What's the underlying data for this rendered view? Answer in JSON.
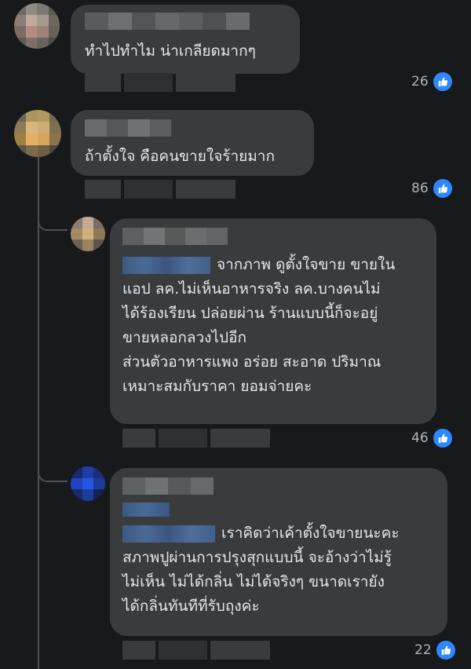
{
  "comments": [
    {
      "text_lines": [
        "ทำไปทำไม น่าเกลียดมากๆ"
      ],
      "likes": "26"
    },
    {
      "text_lines": [
        "ถ้าตั้งใจ คือคนขายใจร้ายมาก"
      ],
      "likes": "86"
    }
  ],
  "replies": [
    {
      "text_lines": [
        "จากภาพ ดูตั้งใจขาย ขายใน",
        "แอป ลค.ไม่เห็นอาหารจริง  ลค.บางคนไม่",
        "ได้ร้องเรียน ปล่อยผ่าน ร้านแบบนี้ก็จะอยู่",
        "ขายหลอกลวงไปอีก",
        "ส่วนตัวอาหารแพง อร่อย สะอาด ปริมาณ",
        "เหมาะสมกับราคา ยอมจ่ายคะ"
      ],
      "likes": "46"
    },
    {
      "text_lines": [
        "เราคิดว่าเค้าตั้งใจขายนะคะ",
        "สภาพปูผ่านการปรุงสุกแบบนี้ จะอ้างว่าไม่รู้",
        "ไม่เห็น ไม่ได้กลิ่น ไม่ได้จริงๆ ขนาดเรายัง",
        "ได้กลิ่นทันทีที่รับถุงค่ะ"
      ],
      "likes": "22"
    }
  ],
  "colors": {
    "background": "#18191a",
    "bubble": "#3a3b3c",
    "text": "#e4e6eb",
    "like_blue": "#2d88ff",
    "meta": "#b0b3b8"
  },
  "icons": {
    "like": "thumbs-up-icon"
  }
}
